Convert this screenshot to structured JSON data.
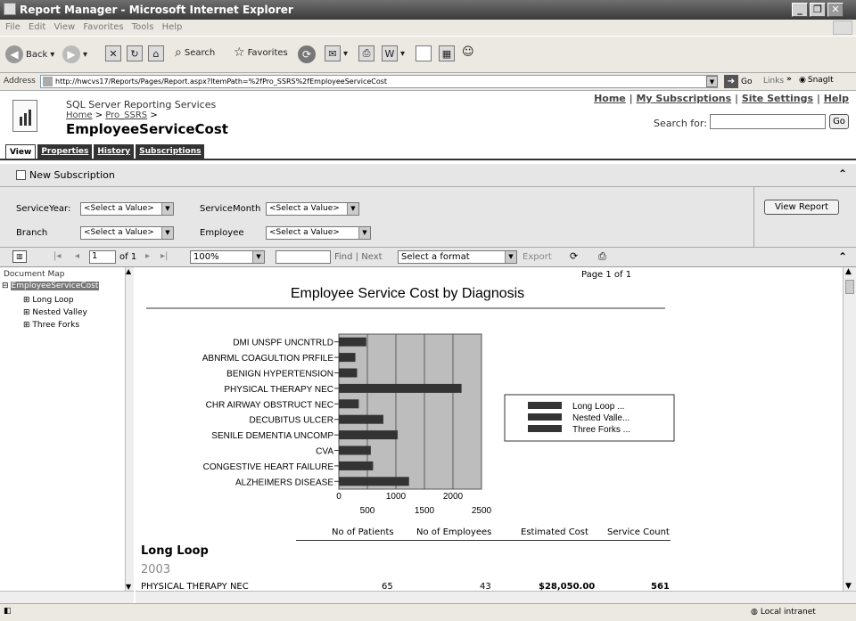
{
  "window": {
    "title": "Report Manager - Microsoft Internet Explorer"
  },
  "menu": [
    "File",
    "Edit",
    "View",
    "Favorites",
    "Tools",
    "Help"
  ],
  "toolbar": {
    "back": "Back",
    "search": "Search",
    "favorites": "Favorites"
  },
  "address": {
    "label": "Address",
    "url": "http://hwcvs17/Reports/Pages/Report.aspx?ItemPath=%2fPro_SSRS%2fEmployeeServiceCost",
    "go": "Go",
    "links": "Links",
    "snagit": "SnagIt"
  },
  "rm": {
    "app_title": "SQL Server Reporting Services",
    "crumb_home": "Home",
    "crumb_sep": " > ",
    "crumb_folder": "Pro_SSRS",
    "crumb_tail": " >",
    "report_name": "EmployeeServiceCost",
    "nav": {
      "home": "Home",
      "subscriptions": "My Subscriptions",
      "settings": "Site Settings",
      "help": "Help",
      "sep": " | "
    },
    "search_label": "Search for:",
    "search_go": "Go",
    "tabs": [
      "View",
      "Properties",
      "History",
      "Subscriptions"
    ]
  },
  "subbar": {
    "new_subscription": "New Subscription"
  },
  "params": {
    "service_year_label": "ServiceYear:",
    "service_month_label": "ServiceMonth",
    "branch_label": "Branch",
    "employee_label": "Employee",
    "select_value": "<Select a Value>",
    "view_report": "View Report"
  },
  "viewer": {
    "page_value": "1",
    "of_pages": "of 1",
    "zoom": "100%",
    "find_input": "",
    "find": "Find",
    "sep": " | ",
    "next": "Next",
    "format": "Select a format",
    "export": "Export"
  },
  "docmap": {
    "title": "Document Map",
    "root": "EmployeeServiceCost",
    "items": [
      "Long Loop",
      "Nested Valley",
      "Three Forks"
    ]
  },
  "report": {
    "page_label": "Page 1 of 1",
    "columns": [
      "No of Patients",
      "No of Employees",
      "Estimated Cost",
      "Service Count"
    ],
    "group": "Long Loop",
    "year": "2003",
    "row": {
      "name": "PHYSICAL THERAPY NEC",
      "patients": "65",
      "employees": "43",
      "cost": "$28,050.00",
      "count": "561"
    }
  },
  "chart_data": {
    "type": "bar",
    "orientation": "horizontal",
    "title": "Employee Service Cost by Diagnosis",
    "categories": [
      "DMI UNSPF UNCNTRLD",
      "ABNRML COAGULTION PRFILE",
      "BENIGN HYPERTENSION",
      "PHYSICAL THERAPY NEC",
      "CHR AIRWAY OBSTRUCT NEC",
      "DECUBITUS ULCER",
      "SENILE DEMENTIA UNCOMP",
      "CVA",
      "CONGESTIVE HEART FAILURE",
      "ALZHEIMERS DISEASE"
    ],
    "series": [
      {
        "name": "Long Loop ...",
        "values": [
          480,
          290,
          320,
          2150,
          350,
          780,
          1030,
          560,
          600,
          1230
        ]
      },
      {
        "name": "Nested  Valle...",
        "values": [
          0,
          0,
          0,
          0,
          0,
          0,
          0,
          0,
          0,
          0
        ]
      },
      {
        "name": "Three Forks ...",
        "values": [
          0,
          0,
          0,
          0,
          0,
          0,
          0,
          0,
          0,
          0
        ]
      }
    ],
    "ticks_top": [
      "0",
      "1000",
      "2000"
    ],
    "ticks_bottom": [
      "500",
      "1500",
      "2500"
    ],
    "xlim": [
      0,
      2500
    ],
    "grid": true,
    "legend": "right",
    "colors": {
      "bar": "#333333",
      "plot_bg": "#bdbdbd",
      "highlight": "#555555"
    }
  },
  "status": {
    "zone": "Local intranet"
  }
}
